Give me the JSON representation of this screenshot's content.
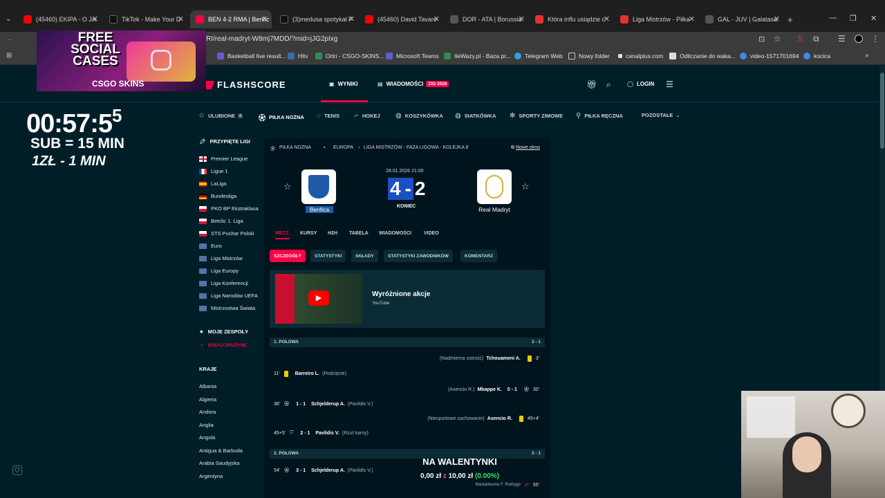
{
  "browser": {
    "tabs": [
      {
        "label": "(45460) EKIPA - O JA",
        "color": "#ff0000"
      },
      {
        "label": "TikTok - Make Your D",
        "color": "#111111"
      },
      {
        "label": "BEN 4-2 RMA | Benfic",
        "color": "#ff0046"
      },
      {
        "label": "(3)medusa spotykał P",
        "color": "#111111"
      },
      {
        "label": "(45460) David Tavare",
        "color": "#ff0000"
      },
      {
        "label": "DOR - ATA | Borussia",
        "color": "#555555"
      },
      {
        "label": "Która influ usiądzie c",
        "color": "#e5322d"
      },
      {
        "label": "Liga Mistrzów - Piłka",
        "color": "#e5322d"
      },
      {
        "label": "GAL - JUV | Galatasa",
        "color": "#555555"
      }
    ],
    "url": "RI/real-madryt-W8mj7MDD/?mid=jJG2pIxg",
    "bookmarks": [
      "Basketball live result...",
      "Hltv",
      "Ortri - CSGO-SKINS...",
      "Microsoft Teams",
      "IleWazy.pl - Baza pr...",
      "Telegram Web",
      "Nowy folder",
      "canalplus.com",
      "Odliczanie do waka...",
      "video-1571701694",
      "kocica"
    ]
  },
  "stream": {
    "timer": "00:57:5",
    "timer_sup": "5",
    "sub_line": "SUB = 15 MIN",
    "zl_line": "1ZŁ - 1 MIN",
    "ad_line1": "FREE",
    "ad_line2": "SOCIAL",
    "ad_line3": "CASES",
    "ad_brand": "CSGO SKINS",
    "goal_title": "NA WALENTYNKI",
    "goal_amount": "0,00 zł",
    "goal_of": "z",
    "goal_target": "10,00 zł",
    "goal_pct": "(0.00%)"
  },
  "site": {
    "logo": "FLASHSCORE",
    "nav_results": "WYNIKI",
    "nav_news": "WIADOMOŚCI",
    "nav_news_badge": "ZIO 2026",
    "login": "LOGIN",
    "sports": [
      "ULUBIONE",
      "PIŁKA NOŻNA",
      "TENIS",
      "HOKEJ",
      "KOSZYKÓWKA",
      "SIATKÓWKA",
      "SPORTY ZIMOWE",
      "PIŁKA RĘCZNA",
      "POZOSTAŁE"
    ],
    "fav_count": "0",
    "pinned_title": "PRZYPIĘTE LIGI",
    "leagues": [
      "Premier League",
      "Ligue 1",
      "LaLiga",
      "Bundesliga",
      "PKO BP Ekstraklasa",
      "Betclic 1. Liga",
      "STS Puchar Polski",
      "Euro",
      "Liga Mistrzów",
      "Liga Europy",
      "Liga Konferencji",
      "Liga Narodów UEFA",
      "Mistrzostwa Świata"
    ],
    "my_teams": "MOJE ZESPOŁY",
    "add_team": "DODAJ DRUŻYNĘ",
    "countries_title": "KRAJE",
    "countries": [
      "Albania",
      "Algieria",
      "Andora",
      "Anglia",
      "Angola",
      "Antigua & Barbuda",
      "Arabia Saudyjska",
      "Argentyna"
    ]
  },
  "match": {
    "breadcrumb": [
      "PIŁKA NOŻNA",
      "EUROPA",
      "LIGA MISTRZÓW - FAZA LIGOWA - KOLEJKA 8"
    ],
    "new_window": "Nowe okno",
    "datetime": "28.01.2026 21:00",
    "home": "Benfica",
    "away": "Real Madryt",
    "score_home": "4",
    "score_sep": "-",
    "score_away": "2",
    "status": "KONIEC",
    "tabs": [
      "MECZ",
      "KURSY",
      "H2H",
      "TABELA",
      "WIADOMOŚCI",
      "VIDEO"
    ],
    "subtabs": [
      "SZCZEGÓŁY",
      "STATYSTYKI",
      "SKŁADY",
      "STATYSTYKI ZAWODNIKÓW",
      "KOMENTARZ"
    ],
    "highlight_title": "Wyróżnione akcje",
    "highlight_source": "YouTube",
    "periods": [
      {
        "label": "1. POŁOWA",
        "score": "2 - 1"
      },
      {
        "label": "2. POŁOWA",
        "score": "2 - 1"
      }
    ],
    "events": [
      {
        "minute": "3'",
        "side": "away",
        "player": "Tchouameni A.",
        "note": "(Nadmierna ostrość)"
      },
      {
        "minute": "11'",
        "side": "home",
        "player": "Barreiro L.",
        "note": "(Podcięcie)"
      },
      {
        "minute": "30'",
        "side": "away",
        "player": "Mbappe K.",
        "note": "(Asencio R.)",
        "score": "0 - 1"
      },
      {
        "minute": "36'",
        "side": "home",
        "player": "Schjelderup A.",
        "note": "(Pavlidis V.)",
        "score": "1 - 1"
      },
      {
        "minute": "45+4'",
        "side": "away",
        "player": "Asencio R.",
        "note": "(Niesportowe zachowanie)"
      },
      {
        "minute": "45+5'",
        "side": "home",
        "player": "Pavlidis V.",
        "note": "(Rzut karny)",
        "score": "2 - 1"
      },
      {
        "minute": "54'",
        "side": "home",
        "player": "Schjelderup A.",
        "note": "(Pavlidis V.)",
        "score": "3 - 1"
      },
      {
        "minute": "55'",
        "side": "away",
        "player": "",
        "note": "Mastantuono F.  Rodrygo"
      }
    ]
  },
  "colors": {
    "accent": "#ff0046",
    "bg": "#001e28",
    "card": "#f5c800"
  }
}
